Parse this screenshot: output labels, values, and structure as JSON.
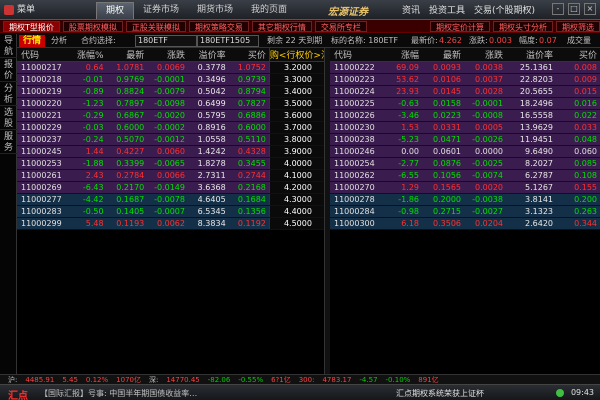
{
  "titlebar": {
    "menu": "菜单",
    "tabs": [
      "期权",
      "证券市场",
      "期货市场",
      "我的页面"
    ],
    "brand": "宏源证券",
    "right_menu": [
      "资讯",
      "投资工具",
      "交易(个股期权)"
    ],
    "win_buttons": [
      "-",
      "□",
      "×"
    ]
  },
  "toolbar": {
    "items": [
      "期权T型报价",
      "股票期权模拟",
      "正股关联模拟",
      "期权策略交易",
      "其它期权行情",
      "交易所专栏",
      "期权定价计算",
      "期权头寸分析",
      "期权筛选"
    ]
  },
  "sidebar": {
    "items": [
      "导航",
      "报价",
      "分析",
      "选股",
      "服务"
    ]
  },
  "filterbar": {
    "tag": "行情",
    "analysis": "分析",
    "contract_label": "合约选择:",
    "contract_value": "180ETF",
    "contract2_value": "180ETF1505",
    "remaining": "剩余 22 天到期",
    "underlying_label": "标的名称: 180ETF",
    "last_label": "最新价:",
    "last_value": "4.262",
    "change_label": "涨跌:",
    "change_value": "0.003",
    "amp_label": "幅度:",
    "amp_value": "0.07",
    "volume_label": "成交量"
  },
  "left_headers": [
    "代码",
    "涨幅%",
    "最新",
    "涨跌",
    "溢价率",
    "买价",
    "购<行权价>沽"
  ],
  "right_headers": [
    "代码",
    "涨幅",
    "最新",
    "涨跌",
    "溢价率",
    "买价"
  ],
  "rows": [
    {
      "lc": "11000217",
      "lp": "0.64",
      "ll": "1.0781",
      "lch": "0.0069",
      "lprem": "0.3778",
      "lbid": "1.0752",
      "strike": "3.2000",
      "rc": "11000222",
      "rp": "69.09",
      "rl": "0.0093",
      "rch": "0.0038",
      "rprem": "25.1361",
      "rbid": "0.008",
      "dir": "up",
      "rdir": "up",
      "bg": "a"
    },
    {
      "lc": "11000218",
      "lp": "-0.01",
      "ll": "0.9769",
      "lch": "-0.0001",
      "lprem": "0.3496",
      "lbid": "0.9739",
      "strike": "3.3000",
      "rc": "11000223",
      "rp": "53.62",
      "rl": "0.0106",
      "rch": "0.0037",
      "rprem": "22.8203",
      "rbid": "0.009",
      "dir": "down",
      "rdir": "up",
      "bg": "a"
    },
    {
      "lc": "11000219",
      "lp": "-0.89",
      "ll": "0.8824",
      "lch": "-0.0079",
      "lprem": "0.5042",
      "lbid": "0.8794",
      "strike": "3.4000",
      "rc": "11000224",
      "rp": "23.93",
      "rl": "0.0145",
      "rch": "0.0028",
      "rprem": "20.5655",
      "rbid": "0.015",
      "dir": "down",
      "rdir": "up",
      "bg": "a"
    },
    {
      "lc": "11000220",
      "lp": "-1.23",
      "ll": "0.7897",
      "lch": "-0.0098",
      "lprem": "0.6499",
      "lbid": "0.7827",
      "strike": "3.5000",
      "rc": "11000225",
      "rp": "-0.63",
      "rl": "0.0158",
      "rch": "-0.0001",
      "rprem": "18.2496",
      "rbid": "0.016",
      "dir": "down",
      "rdir": "down",
      "bg": "a"
    },
    {
      "lc": "11000221",
      "lp": "-0.29",
      "ll": "0.6867",
      "lch": "-0.0020",
      "lprem": "0.5795",
      "lbid": "0.6886",
      "strike": "3.6000",
      "rc": "11000226",
      "rp": "-3.46",
      "rl": "0.0223",
      "rch": "-0.0008",
      "rprem": "16.5558",
      "rbid": "0.022",
      "dir": "down",
      "rdir": "down",
      "bg": "a"
    },
    {
      "lc": "11000229",
      "lp": "-0.03",
      "ll": "0.6000",
      "lch": "-0.0002",
      "lprem": "0.8916",
      "lbid": "0.6000",
      "strike": "3.7000",
      "rc": "11000230",
      "rp": "1.53",
      "rl": "0.0331",
      "rch": "0.0005",
      "rprem": "13.9629",
      "rbid": "0.033",
      "dir": "down",
      "rdir": "up",
      "bg": "a"
    },
    {
      "lc": "11000237",
      "lp": "-0.24",
      "ll": "0.5070",
      "lch": "-0.0012",
      "lprem": "1.0558",
      "lbid": "0.5110",
      "strike": "3.8000",
      "rc": "11000238",
      "rp": "-5.23",
      "rl": "0.0471",
      "rch": "-0.0026",
      "rprem": "11.9451",
      "rbid": "0.048",
      "dir": "down",
      "rdir": "down",
      "bg": "a"
    },
    {
      "lc": "11000245",
      "lp": "1.44",
      "ll": "0.4227",
      "lch": "0.0060",
      "lprem": "1.4242",
      "lbid": "0.4328",
      "strike": "3.9000",
      "rc": "11000246",
      "rp": "0.00",
      "rl": "0.0601",
      "rch": "0.0000",
      "rprem": "9.6490",
      "rbid": "0.060",
      "dir": "up",
      "rdir": "flat",
      "bg": "a"
    },
    {
      "lc": "11000253",
      "lp": "-1.88",
      "ll": "0.3399",
      "lch": "-0.0065",
      "lprem": "1.8278",
      "lbid": "0.3455",
      "strike": "4.0000",
      "rc": "11000254",
      "rp": "-2.77",
      "rl": "0.0876",
      "rch": "-0.0025",
      "rprem": "8.2027",
      "rbid": "0.085",
      "dir": "down",
      "rdir": "down",
      "bg": "a"
    },
    {
      "lc": "11000261",
      "lp": "2.43",
      "ll": "0.2784",
      "lch": "0.0066",
      "lprem": "2.7311",
      "lbid": "0.2744",
      "strike": "4.1000",
      "rc": "11000262",
      "rp": "-6.55",
      "rl": "0.1056",
      "rch": "-0.0074",
      "rprem": "6.2787",
      "rbid": "0.108",
      "dir": "up",
      "rdir": "down",
      "bg": "a"
    },
    {
      "lc": "11000269",
      "lp": "-6.43",
      "ll": "0.2170",
      "lch": "-0.0149",
      "lprem": "3.6368",
      "lbid": "0.2168",
      "strike": "4.2000",
      "rc": "11000270",
      "rp": "1.29",
      "rl": "0.1565",
      "rch": "0.0020",
      "rprem": "5.1267",
      "rbid": "0.155",
      "dir": "down",
      "rdir": "up",
      "bg": "a"
    },
    {
      "lc": "11000277",
      "lp": "-4.42",
      "ll": "0.1687",
      "lch": "-0.0078",
      "lprem": "4.6405",
      "lbid": "0.1684",
      "strike": "4.3000",
      "rc": "11000278",
      "rp": "-1.86",
      "rl": "0.2000",
      "rch": "-0.0038",
      "rprem": "3.8141",
      "rbid": "0.200",
      "dir": "down",
      "rdir": "down",
      "bg": "b"
    },
    {
      "lc": "11000283",
      "lp": "-0.50",
      "ll": "0.1405",
      "lch": "-0.0007",
      "lprem": "6.5345",
      "lbid": "0.1356",
      "strike": "4.4000",
      "rc": "11000284",
      "rp": "-0.98",
      "rl": "0.2715",
      "rch": "-0.0027",
      "rprem": "3.1323",
      "rbid": "0.263",
      "dir": "down",
      "rdir": "down",
      "bg": "b"
    },
    {
      "lc": "11000299",
      "lp": "5.48",
      "ll": "0.1193",
      "lch": "0.0062",
      "lprem": "8.3834",
      "lbid": "0.1192",
      "strike": "4.5000",
      "rc": "11000300",
      "rp": "6.18",
      "rl": "0.3506",
      "rch": "0.0204",
      "rprem": "2.6420",
      "rbid": "0.344",
      "dir": "up",
      "rdir": "up",
      "bg": "b"
    }
  ],
  "statusbar": [
    "沪:",
    "4485.91",
    "5.45",
    "0.12%",
    "1070亿",
    "深:",
    "14770.45",
    "-82.06",
    "-0.55%",
    "6?1亿",
    "300:",
    "4783.17",
    "-4.57",
    "-0.10%",
    "891亿"
  ],
  "bottombar": {
    "hui": "汇点",
    "ticker": "【国际汇报】号事: 中国半年期国债收益率…",
    "notice": "汇点期权系统荣获上证杯",
    "clock": "09:43"
  }
}
